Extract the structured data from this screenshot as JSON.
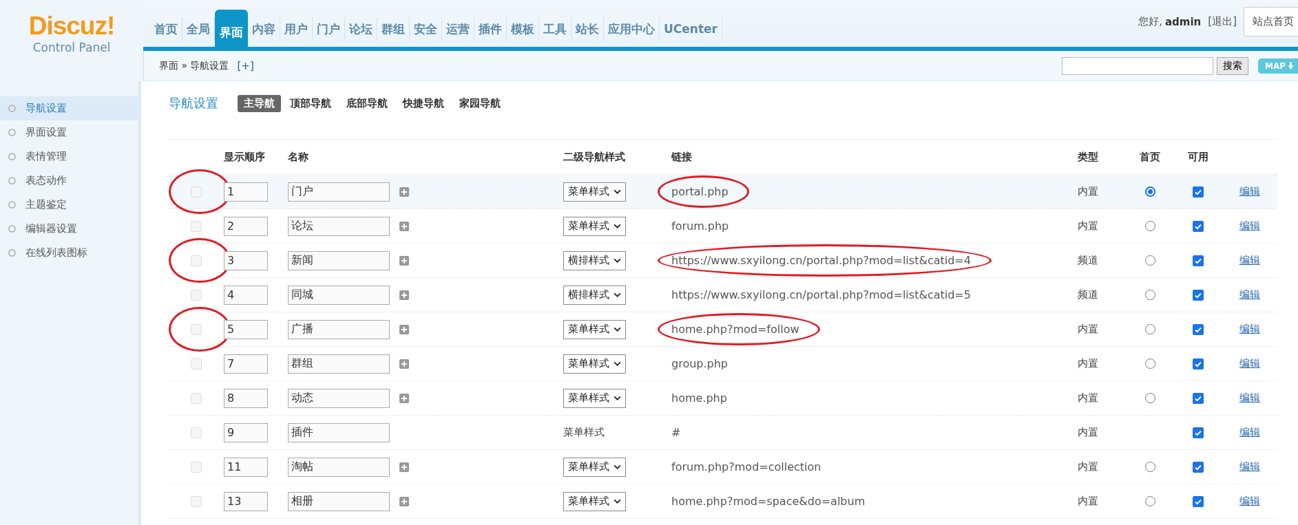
{
  "logo": {
    "title": "Discuz!",
    "subtitle": "Control Panel"
  },
  "top_nav": [
    {
      "label": "首页",
      "selected": false
    },
    {
      "label": "全局",
      "selected": false
    },
    {
      "label": "界面",
      "selected": true
    },
    {
      "label": "内容",
      "selected": false
    },
    {
      "label": "用户",
      "selected": false
    },
    {
      "label": "门户",
      "selected": false
    },
    {
      "label": "论坛",
      "selected": false
    },
    {
      "label": "群组",
      "selected": false
    },
    {
      "label": "安全",
      "selected": false
    },
    {
      "label": "运营",
      "selected": false
    },
    {
      "label": "插件",
      "selected": false
    },
    {
      "label": "模板",
      "selected": false
    },
    {
      "label": "工具",
      "selected": false
    },
    {
      "label": "站长",
      "selected": false
    },
    {
      "label": "应用中心",
      "selected": false
    },
    {
      "label": "UCenter",
      "selected": false
    }
  ],
  "user": {
    "greeting": "您好,",
    "name": "admin",
    "logout": "[退出]",
    "site_home": "站点首页"
  },
  "breadcrumb": {
    "path": "界面 » 导航设置",
    "add": "[+]"
  },
  "search": {
    "button": "搜索",
    "map": "MAP"
  },
  "sidebar": {
    "items": [
      {
        "label": "导航设置",
        "selected": true
      },
      {
        "label": "界面设置",
        "selected": false
      },
      {
        "label": "表情管理",
        "selected": false
      },
      {
        "label": "表态动作",
        "selected": false
      },
      {
        "label": "主题鉴定",
        "selected": false
      },
      {
        "label": "编辑器设置",
        "selected": false
      },
      {
        "label": "在线列表图标",
        "selected": false
      }
    ]
  },
  "page_title": "导航设置",
  "sub_tabs": [
    {
      "label": "主导航",
      "selected": true
    },
    {
      "label": "顶部导航",
      "selected": false
    },
    {
      "label": "底部导航",
      "selected": false
    },
    {
      "label": "快捷导航",
      "selected": false
    },
    {
      "label": "家园导航",
      "selected": false
    }
  ],
  "table": {
    "columns": [
      "显示顺序",
      "名称",
      "二级导航样式",
      "链接",
      "类型",
      "首页",
      "可用"
    ],
    "rows": [
      {
        "highlighted": true,
        "delete_disabled": true,
        "order": "1",
        "name": "门户",
        "addable": true,
        "style": {
          "kind": "select",
          "value": "菜单样式"
        },
        "link": "portal.php",
        "type": "内置",
        "homepage_radio": true,
        "homepage_selected": true,
        "enabled": true,
        "edit": "编辑",
        "checkbox_circled": true,
        "link_circled": true
      },
      {
        "highlighted": false,
        "delete_disabled": true,
        "order": "2",
        "name": "论坛",
        "addable": true,
        "style": {
          "kind": "select",
          "value": "菜单样式"
        },
        "link": "forum.php",
        "type": "内置",
        "homepage_radio": true,
        "homepage_selected": false,
        "enabled": true,
        "edit": "编辑",
        "checkbox_circled": false,
        "link_circled": false
      },
      {
        "highlighted": false,
        "delete_disabled": true,
        "order": "3",
        "name": "新闻",
        "addable": true,
        "style": {
          "kind": "select",
          "value": "横排样式"
        },
        "link": "https://www.sxyilong.cn/portal.php?mod=list&catid=4",
        "type": "频道",
        "homepage_radio": true,
        "homepage_selected": false,
        "enabled": true,
        "edit": "编辑",
        "checkbox_circled": true,
        "link_circled": true
      },
      {
        "highlighted": false,
        "delete_disabled": true,
        "order": "4",
        "name": "同城",
        "addable": true,
        "style": {
          "kind": "select",
          "value": "横排样式"
        },
        "link": "https://www.sxyilong.cn/portal.php?mod=list&catid=5",
        "type": "频道",
        "homepage_radio": true,
        "homepage_selected": false,
        "enabled": true,
        "edit": "编辑",
        "checkbox_circled": false,
        "link_circled": false
      },
      {
        "highlighted": false,
        "delete_disabled": true,
        "order": "5",
        "name": "广播",
        "addable": true,
        "style": {
          "kind": "select",
          "value": "菜单样式"
        },
        "link": "home.php?mod=follow",
        "type": "内置",
        "homepage_radio": true,
        "homepage_selected": false,
        "enabled": true,
        "edit": "编辑",
        "checkbox_circled": true,
        "link_circled": true
      },
      {
        "highlighted": false,
        "delete_disabled": true,
        "order": "7",
        "name": "群组",
        "addable": true,
        "style": {
          "kind": "select",
          "value": "菜单样式"
        },
        "link": "group.php",
        "type": "内置",
        "homepage_radio": true,
        "homepage_selected": false,
        "enabled": true,
        "edit": "编辑",
        "checkbox_circled": false,
        "link_circled": false
      },
      {
        "highlighted": false,
        "delete_disabled": true,
        "order": "8",
        "name": "动态",
        "addable": true,
        "style": {
          "kind": "select",
          "value": "菜单样式"
        },
        "link": "home.php",
        "type": "内置",
        "homepage_radio": true,
        "homepage_selected": false,
        "enabled": true,
        "edit": "编辑",
        "checkbox_circled": false,
        "link_circled": false
      },
      {
        "highlighted": false,
        "delete_disabled": true,
        "order": "9",
        "name": "插件",
        "addable": false,
        "style": {
          "kind": "text",
          "value": "菜单样式"
        },
        "link": "#",
        "type": "内置",
        "homepage_radio": false,
        "enabled": true,
        "edit": "编辑",
        "checkbox_circled": false,
        "link_circled": false
      },
      {
        "highlighted": false,
        "delete_disabled": true,
        "order": "11",
        "name": "淘帖",
        "addable": true,
        "style": {
          "kind": "select",
          "value": "菜单样式"
        },
        "link": "forum.php?mod=collection",
        "type": "内置",
        "homepage_radio": true,
        "homepage_selected": false,
        "enabled": true,
        "edit": "编辑",
        "checkbox_circled": false,
        "link_circled": false
      },
      {
        "highlighted": false,
        "delete_disabled": true,
        "order": "13",
        "name": "相册",
        "addable": true,
        "style": {
          "kind": "select",
          "value": "菜单样式"
        },
        "link": "home.php?mod=space&do=album",
        "type": "内置",
        "homepage_radio": true,
        "homepage_selected": false,
        "enabled": true,
        "edit": "编辑",
        "checkbox_circled": false,
        "link_circled": false
      }
    ]
  }
}
